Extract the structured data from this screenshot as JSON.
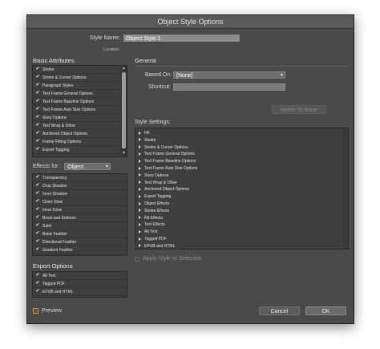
{
  "dialog": {
    "title": "Object Style Options"
  },
  "style_name": {
    "label": "Style Name:",
    "value": "Object Style 1"
  },
  "location": {
    "label": "Location:"
  },
  "basic_attributes": {
    "heading": "Basic Attributes",
    "items": [
      {
        "label": "Stroke",
        "checked": true
      },
      {
        "label": "Stroke & Corner Options",
        "checked": true
      },
      {
        "label": "Paragraph Styles",
        "checked": true
      },
      {
        "label": "Text Frame General Options",
        "checked": true
      },
      {
        "label": "Text Frame Baseline Options",
        "checked": true
      },
      {
        "label": "Text Frame Auto Size Options",
        "checked": true
      },
      {
        "label": "Story Options",
        "checked": true
      },
      {
        "label": "Text Wrap & Other",
        "checked": true
      },
      {
        "label": "Anchored Object Options",
        "checked": true
      },
      {
        "label": "Frame Fitting Options",
        "checked": true
      },
      {
        "label": "Export Tagging",
        "checked": true
      }
    ]
  },
  "effects_for": {
    "label": "Effects for:",
    "value": "Object",
    "items": [
      {
        "label": "Transparency",
        "checked": true
      },
      {
        "label": "Drop Shadow",
        "checked": true
      },
      {
        "label": "Inner Shadow",
        "checked": true
      },
      {
        "label": "Outer Glow",
        "checked": true
      },
      {
        "label": "Inner Glow",
        "checked": true
      },
      {
        "label": "Bevel and Emboss",
        "checked": true
      },
      {
        "label": "Satin",
        "checked": true
      },
      {
        "label": "Basic Feather",
        "checked": true
      },
      {
        "label": "Directional Feather",
        "checked": true
      },
      {
        "label": "Gradient Feather",
        "checked": true
      }
    ]
  },
  "export_options": {
    "heading": "Export Options",
    "items": [
      {
        "label": "Alt Text",
        "checked": true
      },
      {
        "label": "Tagged PDF",
        "checked": true
      },
      {
        "label": "EPUB and HTML",
        "checked": true
      }
    ]
  },
  "general": {
    "heading": "General",
    "based_on_label": "Based On:",
    "based_on_value": "[None]",
    "shortcut_label": "Shortcut:",
    "shortcut_value": "",
    "reset_button": "Reset To Base"
  },
  "style_settings": {
    "heading": "Style Settings:",
    "items": [
      "Fill",
      "Stroke",
      "Stroke & Corner Options",
      "Text Frame General Options",
      "Text Frame Baseline Options",
      "Text Frame Auto Size Options",
      "Story Options",
      "Text Wrap & Other",
      "Anchored Object Options",
      "Export Tagging",
      "Object Effects",
      "Stroke Effects",
      "Fill Effects",
      "Text Effects",
      "Alt Text",
      "Tagged PDF",
      "EPUB and HTML"
    ]
  },
  "apply_style": {
    "label": "Apply Style to Selection",
    "checked": false
  },
  "preview": {
    "label": "Preview",
    "checked": false
  },
  "buttons": {
    "cancel": "Cancel",
    "ok": "OK"
  },
  "icons": {
    "check": "checkmark-icon",
    "dropdown": "chevron-down-icon",
    "expand": "disclosure-triangle-icon"
  }
}
